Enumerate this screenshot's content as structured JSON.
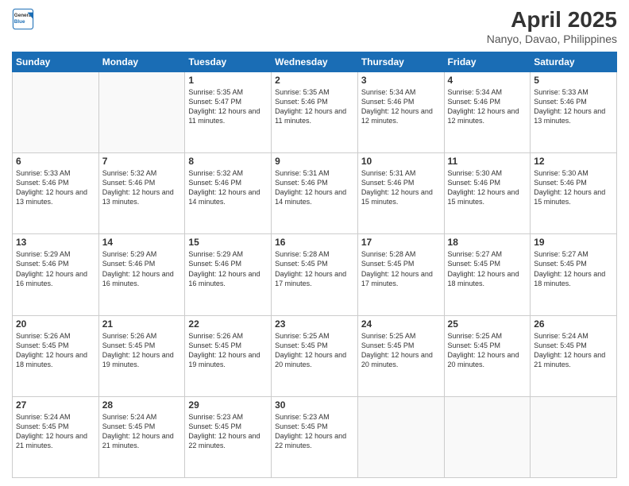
{
  "header": {
    "logo_line1": "General",
    "logo_line2": "Blue",
    "title": "April 2025",
    "subtitle": "Nanyo, Davao, Philippines"
  },
  "days_of_week": [
    "Sunday",
    "Monday",
    "Tuesday",
    "Wednesday",
    "Thursday",
    "Friday",
    "Saturday"
  ],
  "weeks": [
    [
      {
        "day": "",
        "info": ""
      },
      {
        "day": "",
        "info": ""
      },
      {
        "day": "1",
        "info": "Sunrise: 5:35 AM\nSunset: 5:47 PM\nDaylight: 12 hours and 11 minutes."
      },
      {
        "day": "2",
        "info": "Sunrise: 5:35 AM\nSunset: 5:46 PM\nDaylight: 12 hours and 11 minutes."
      },
      {
        "day": "3",
        "info": "Sunrise: 5:34 AM\nSunset: 5:46 PM\nDaylight: 12 hours and 12 minutes."
      },
      {
        "day": "4",
        "info": "Sunrise: 5:34 AM\nSunset: 5:46 PM\nDaylight: 12 hours and 12 minutes."
      },
      {
        "day": "5",
        "info": "Sunrise: 5:33 AM\nSunset: 5:46 PM\nDaylight: 12 hours and 13 minutes."
      }
    ],
    [
      {
        "day": "6",
        "info": "Sunrise: 5:33 AM\nSunset: 5:46 PM\nDaylight: 12 hours and 13 minutes."
      },
      {
        "day": "7",
        "info": "Sunrise: 5:32 AM\nSunset: 5:46 PM\nDaylight: 12 hours and 13 minutes."
      },
      {
        "day": "8",
        "info": "Sunrise: 5:32 AM\nSunset: 5:46 PM\nDaylight: 12 hours and 14 minutes."
      },
      {
        "day": "9",
        "info": "Sunrise: 5:31 AM\nSunset: 5:46 PM\nDaylight: 12 hours and 14 minutes."
      },
      {
        "day": "10",
        "info": "Sunrise: 5:31 AM\nSunset: 5:46 PM\nDaylight: 12 hours and 15 minutes."
      },
      {
        "day": "11",
        "info": "Sunrise: 5:30 AM\nSunset: 5:46 PM\nDaylight: 12 hours and 15 minutes."
      },
      {
        "day": "12",
        "info": "Sunrise: 5:30 AM\nSunset: 5:46 PM\nDaylight: 12 hours and 15 minutes."
      }
    ],
    [
      {
        "day": "13",
        "info": "Sunrise: 5:29 AM\nSunset: 5:46 PM\nDaylight: 12 hours and 16 minutes."
      },
      {
        "day": "14",
        "info": "Sunrise: 5:29 AM\nSunset: 5:46 PM\nDaylight: 12 hours and 16 minutes."
      },
      {
        "day": "15",
        "info": "Sunrise: 5:29 AM\nSunset: 5:46 PM\nDaylight: 12 hours and 16 minutes."
      },
      {
        "day": "16",
        "info": "Sunrise: 5:28 AM\nSunset: 5:45 PM\nDaylight: 12 hours and 17 minutes."
      },
      {
        "day": "17",
        "info": "Sunrise: 5:28 AM\nSunset: 5:45 PM\nDaylight: 12 hours and 17 minutes."
      },
      {
        "day": "18",
        "info": "Sunrise: 5:27 AM\nSunset: 5:45 PM\nDaylight: 12 hours and 18 minutes."
      },
      {
        "day": "19",
        "info": "Sunrise: 5:27 AM\nSunset: 5:45 PM\nDaylight: 12 hours and 18 minutes."
      }
    ],
    [
      {
        "day": "20",
        "info": "Sunrise: 5:26 AM\nSunset: 5:45 PM\nDaylight: 12 hours and 18 minutes."
      },
      {
        "day": "21",
        "info": "Sunrise: 5:26 AM\nSunset: 5:45 PM\nDaylight: 12 hours and 19 minutes."
      },
      {
        "day": "22",
        "info": "Sunrise: 5:26 AM\nSunset: 5:45 PM\nDaylight: 12 hours and 19 minutes."
      },
      {
        "day": "23",
        "info": "Sunrise: 5:25 AM\nSunset: 5:45 PM\nDaylight: 12 hours and 20 minutes."
      },
      {
        "day": "24",
        "info": "Sunrise: 5:25 AM\nSunset: 5:45 PM\nDaylight: 12 hours and 20 minutes."
      },
      {
        "day": "25",
        "info": "Sunrise: 5:25 AM\nSunset: 5:45 PM\nDaylight: 12 hours and 20 minutes."
      },
      {
        "day": "26",
        "info": "Sunrise: 5:24 AM\nSunset: 5:45 PM\nDaylight: 12 hours and 21 minutes."
      }
    ],
    [
      {
        "day": "27",
        "info": "Sunrise: 5:24 AM\nSunset: 5:45 PM\nDaylight: 12 hours and 21 minutes."
      },
      {
        "day": "28",
        "info": "Sunrise: 5:24 AM\nSunset: 5:45 PM\nDaylight: 12 hours and 21 minutes."
      },
      {
        "day": "29",
        "info": "Sunrise: 5:23 AM\nSunset: 5:45 PM\nDaylight: 12 hours and 22 minutes."
      },
      {
        "day": "30",
        "info": "Sunrise: 5:23 AM\nSunset: 5:45 PM\nDaylight: 12 hours and 22 minutes."
      },
      {
        "day": "",
        "info": ""
      },
      {
        "day": "",
        "info": ""
      },
      {
        "day": "",
        "info": ""
      }
    ]
  ]
}
